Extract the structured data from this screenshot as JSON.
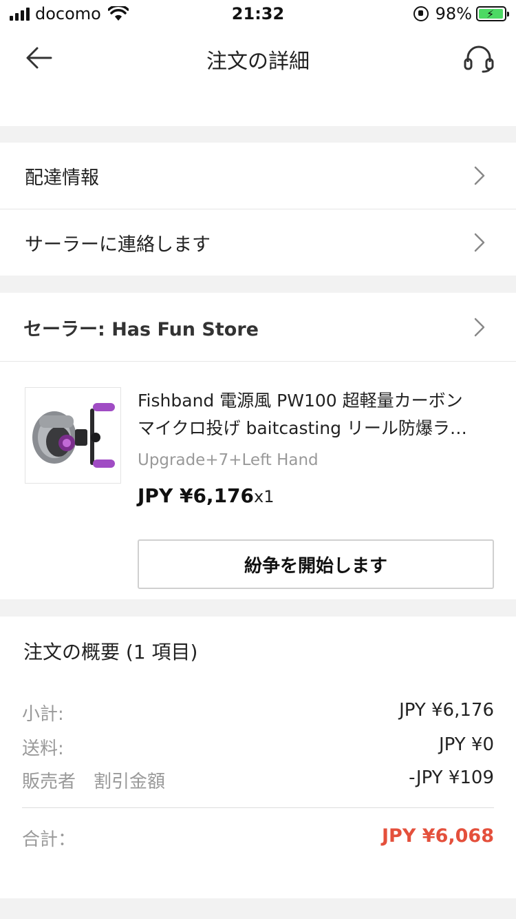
{
  "status_bar": {
    "carrier": "docomo",
    "time": "21:32",
    "battery_percent": "98%",
    "battery_level": 0.98,
    "battery_color": "#4cd964"
  },
  "nav": {
    "title": "注文の詳細",
    "back_icon": "arrow-left-icon",
    "support_icon": "headset-icon"
  },
  "rows": {
    "delivery_info": "配達情報",
    "contact_seller": "サーラーに連絡します"
  },
  "seller": {
    "label": "セーラー: Has Fun Store"
  },
  "product": {
    "title_line1": "Fishband 電源風 PW100 超軽量カーボン",
    "title_line2": "マイクロ投げ baitcasting リール防爆ラ…",
    "variant": "Upgrade+7+Left Hand",
    "price": "JPY ¥6,176",
    "quantity": "x1",
    "dispute_button": "紛争を開始します"
  },
  "summary": {
    "title": "注文の概要 (1 項目)",
    "subtotal_label": "小計:",
    "subtotal_value": "JPY ¥6,176",
    "shipping_label": "送料:",
    "shipping_value": "JPY ¥0",
    "discount_label": "販売者　割引金額",
    "discount_value": "-JPY ¥109",
    "total_label": "合計：",
    "total_value": "JPY ¥6,068",
    "total_color": "#e4503c"
  }
}
